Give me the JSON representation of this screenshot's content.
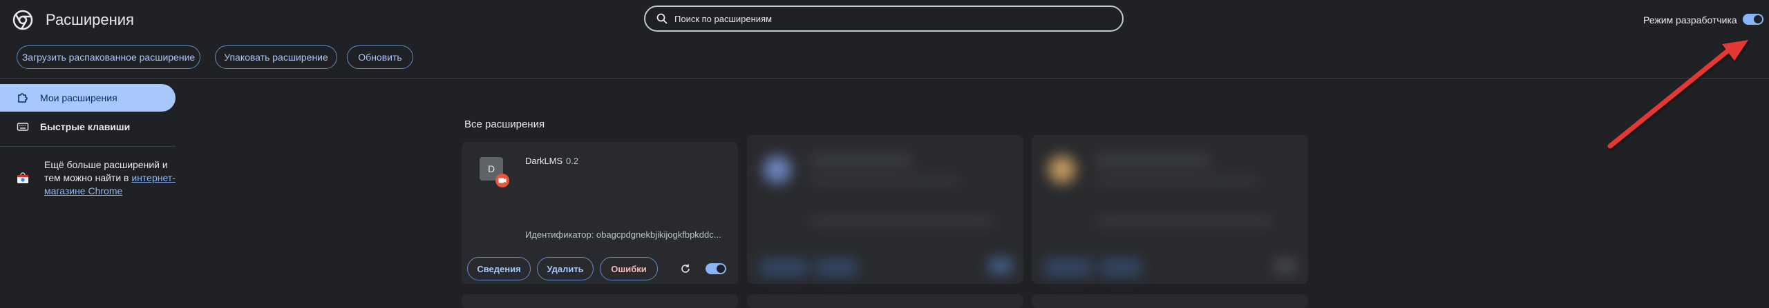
{
  "header": {
    "title": "Расширения",
    "search_placeholder": "Поиск по расширениям",
    "dev_mode_label": "Режим разработчика",
    "dev_mode_enabled": true
  },
  "toolbar": {
    "load_unpacked": "Загрузить распакованное расширение",
    "pack": "Упаковать расширение",
    "update": "Обновить"
  },
  "sidebar": {
    "items": [
      {
        "label": "Мои расширения",
        "selected": true,
        "icon": "puzzle-icon"
      },
      {
        "label": "Быстрые клавиши",
        "selected": false,
        "icon": "keyboard-icon"
      }
    ],
    "store_text": "Ещё больше расширений и тем можно найти в",
    "store_link": "интернет-магазине Chrome"
  },
  "main": {
    "section_title": "Все расширения",
    "extensions": [
      {
        "icon_letter": "D",
        "name": "DarkLMS",
        "version": "0.2",
        "id_text": "Идентификатор: obagcpdgnekbjikijogkfbpkddc...",
        "details_label": "Сведения",
        "remove_label": "Удалить",
        "errors_label": "Ошибки",
        "enabled": true
      }
    ]
  },
  "colors": {
    "background": "#202124",
    "accent": "#a8c7fa",
    "error": "#f2b8b5",
    "annotation_arrow": "#e53935"
  }
}
